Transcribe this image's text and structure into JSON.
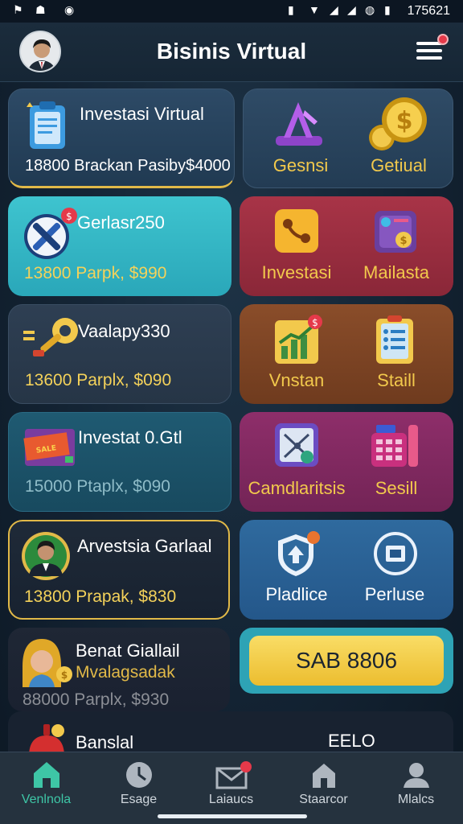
{
  "status_bar": {
    "time": "175621"
  },
  "header": {
    "title": "Bisinis Virtual"
  },
  "cards": {
    "investasi_virtual": {
      "title": "Investasi Virtual",
      "subtitle": "18800 Brackan Pasiby$4000"
    },
    "gerlasr": {
      "title": "Gerlasr250",
      "subtitle": "13800 Parpk, $990"
    },
    "vaalapy": {
      "title": "Vaalapy330",
      "subtitle": "13600 Parplx, $090"
    },
    "investat": {
      "title": "Investat 0.Gtl",
      "subtitle": "15000 Ptaplx, $090"
    },
    "arvestsia": {
      "title": "Arvestsia Garlaal",
      "subtitle": "13800 Prapak, $830"
    },
    "benat": {
      "title": "Benat Giallail",
      "subtitle2": "Mvalagsadak",
      "subtitle": "88000 Parplx, $930"
    },
    "banslal": {
      "title": "Banslal"
    }
  },
  "tiles": {
    "gensni": "Gesnsi",
    "getiual": "Getiual",
    "investasi": "Investasi",
    "mailasta": "Mailasta",
    "vnstan": "Vnstan",
    "staill": "Staill",
    "camdlaritsis": "Camdlaritsis",
    "sesill": "Sesill",
    "pladlice": "Pladlice",
    "perluse": "Perluse",
    "eelo": "EELO"
  },
  "promo_button": {
    "label": "SAB 8806"
  },
  "nav": [
    {
      "label": "Venlnola",
      "icon": "home-icon",
      "active": true
    },
    {
      "label": "Esage",
      "icon": "clock-icon"
    },
    {
      "label": "Laiaucs",
      "icon": "mail-icon"
    },
    {
      "label": "Staarcor",
      "icon": "store-icon"
    },
    {
      "label": "Mlalcs",
      "icon": "profile-icon"
    }
  ],
  "colors": {
    "accent_gold": "#f2c94c",
    "active_nav": "#3ec6a6",
    "badge_red": "#e5394a"
  }
}
